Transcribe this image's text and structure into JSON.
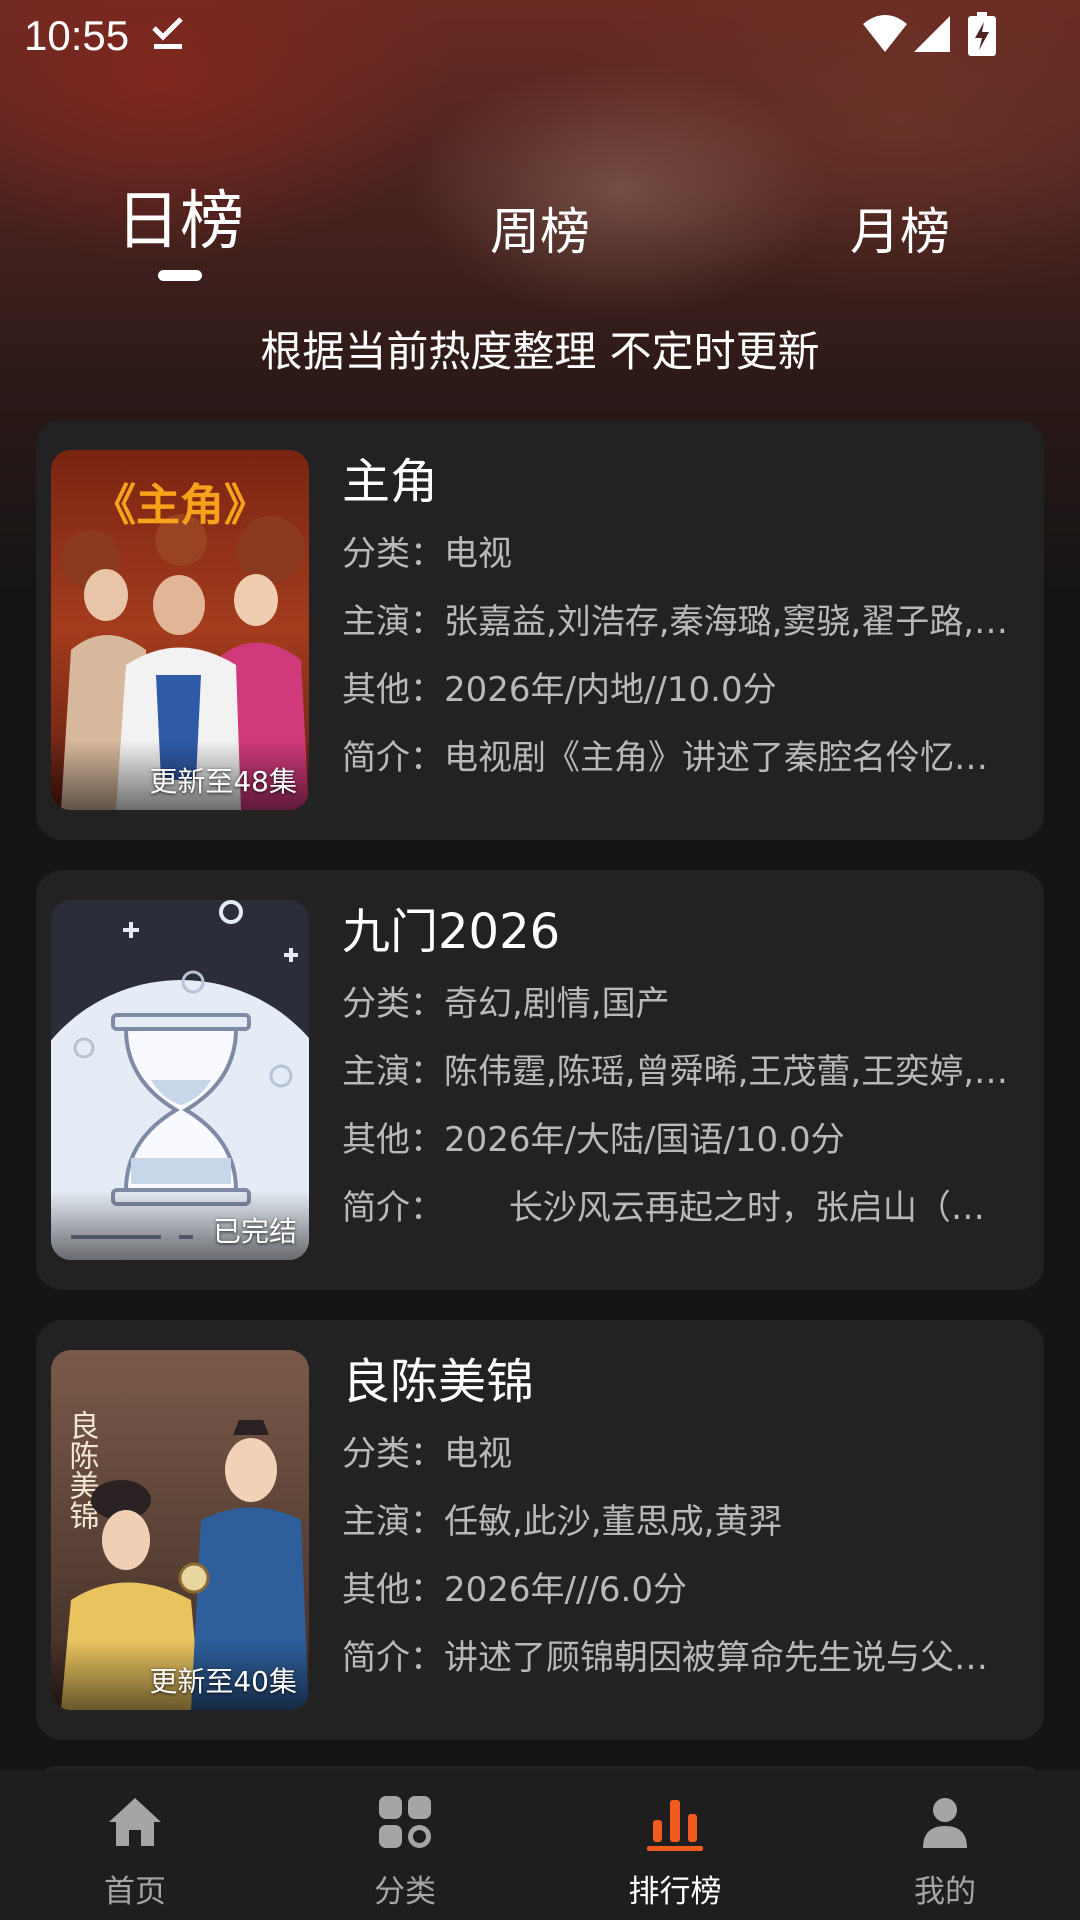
{
  "status_bar": {
    "time": "10:55"
  },
  "tabs": [
    {
      "label": "日榜",
      "active": true
    },
    {
      "label": "周榜",
      "active": false
    },
    {
      "label": "月榜",
      "active": false
    }
  ],
  "subtitle": "根据当前热度整理 不定时更新",
  "items": [
    {
      "title": "主角",
      "badge": "更新至48集",
      "category": "分类：电视",
      "cast": "主演：张嘉益,刘浩存,秦海璐,窦骁,翟子路,…",
      "other": "其他：2026年/内地//10.0分",
      "intro": "简介：电视剧《主角》讲述了秦腔名伶忆…"
    },
    {
      "title": "九门2026",
      "badge": "已完结",
      "category": "分类：奇幻,剧情,国产",
      "cast": "主演：陈伟霆,陈瑶,曾舜晞,王茂蕾,王奕婷,…",
      "other": "其他：2026年/大陆/国语/10.0分",
      "intro": "简介：      长沙风云再起之时，张启山（…"
    },
    {
      "title": "良陈美锦",
      "badge": "更新至40集",
      "category": "分类：电视",
      "cast": "主演：任敏,此沙,董思成,黄羿",
      "other": "其他：2026年///6.0分",
      "intro": "简介：讲述了顾锦朝因被算命先生说与父…"
    }
  ],
  "poster_texts": {
    "poster1_logo": "《主角》",
    "poster3_logo": "良陈美锦"
  },
  "bottom_nav": [
    {
      "label": "首页",
      "icon": "home-icon",
      "active": false
    },
    {
      "label": "分类",
      "icon": "category-icon",
      "active": false
    },
    {
      "label": "排行榜",
      "icon": "ranking-icon",
      "active": true
    },
    {
      "label": "我的",
      "icon": "profile-icon",
      "active": false
    }
  ],
  "colors": {
    "accent": "#f25a1e",
    "card_bg": "#222222",
    "page_bg": "#141414"
  }
}
